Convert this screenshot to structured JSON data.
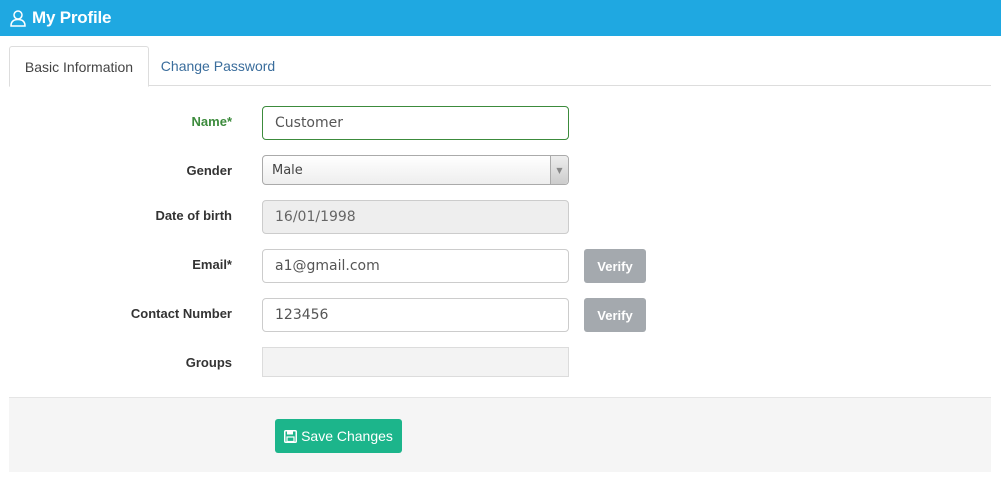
{
  "header": {
    "title": "My Profile",
    "icon": "user-icon"
  },
  "tabs": [
    {
      "label": "Basic Information",
      "active": true
    },
    {
      "label": "Change Password",
      "active": false
    }
  ],
  "form": {
    "name": {
      "label": "Name*",
      "value": "Customer"
    },
    "gender": {
      "label": "Gender",
      "value": "Male"
    },
    "dob": {
      "label": "Date of birth",
      "value": "16/01/1998"
    },
    "email": {
      "label": "Email*",
      "value": "a1@gmail.com",
      "verify_label": "Verify"
    },
    "contact": {
      "label": "Contact Number",
      "value": "123456",
      "verify_label": "Verify"
    },
    "groups": {
      "label": "Groups",
      "value": ""
    }
  },
  "footer": {
    "save_label": "Save Changes",
    "save_icon": "floppy-disk-icon"
  },
  "colors": {
    "header_bg": "#1fa8e1",
    "success_green": "#3c8b3c",
    "save_button": "#1cb58b",
    "verify_button": "#a4a9ae",
    "link_blue": "#3a6d9c"
  }
}
